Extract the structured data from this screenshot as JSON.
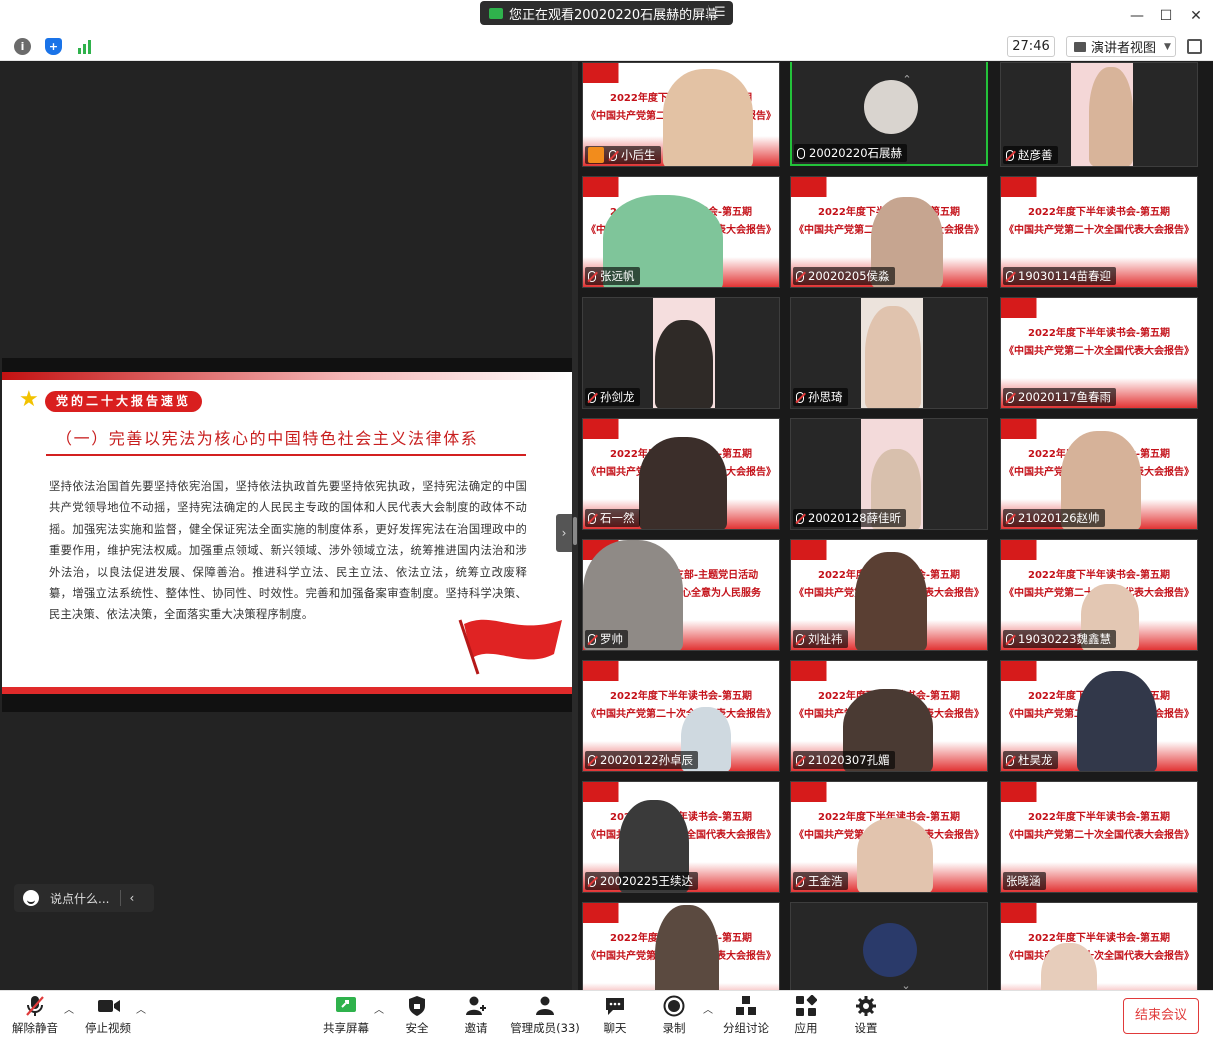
{
  "titlebar": {
    "sharing_text": "您正在观看20020220石展赫的屏幕",
    "colors": {
      "sharing_pill": "#2d2d2d",
      "share_icon": "#2fb24c"
    }
  },
  "toolbar": {
    "timer": "27:46",
    "view_label": "演讲者视图"
  },
  "slide": {
    "tag": "党的二十大报告速览",
    "title": "（一）完善以宪法为核心的中国特色社会主义法律体系",
    "body": "坚持依法治国首先要坚持依宪治国，坚持依法执政首先要坚持依宪执政，坚持宪法确定的中国共产党领导地位不动摇，坚持宪法确定的人民民主专政的国体和人民代表大会制度的政体不动摇。加强宪法实施和监督，健全保证宪法全面实施的制度体系，更好发挥宪法在治国理政中的重要作用，维护宪法权威。加强重点领域、新兴领域、涉外领域立法，统筹推进国内法治和涉外法治，以良法促进发展、保障善治。推进科学立法、民主立法、依法立法，统筹立改废释纂，增强立法系统性、整体性、协同性、时效性。完善和加强备案审查制度。坚持科学决策、民主决策、依法决策，全面落实重大决策程序制度。",
    "colors": {
      "accent": "#d91f1f"
    }
  },
  "chat": {
    "placeholder": "说点什么..."
  },
  "poster": {
    "line1": "2022年度下半年读书会-第五期",
    "line2": "《中国共产党第二十次全国代表大会报告》",
    "alt_line1": "学生党支部-主题党日活动",
    "alt_line2": "心全意为人民服务"
  },
  "participants": [
    {
      "name": "小后生"
    },
    {
      "name": "20020220石展赫"
    },
    {
      "name": "赵彦善"
    },
    {
      "name": "张远帆"
    },
    {
      "name": "20020205侯淼"
    },
    {
      "name": "19030114苗春迎"
    },
    {
      "name": "孙剑龙"
    },
    {
      "name": "孙思琦"
    },
    {
      "name": "20020117鱼春雨"
    },
    {
      "name": "石一然"
    },
    {
      "name": "20020128薛佳昕"
    },
    {
      "name": "21020126赵帅"
    },
    {
      "name": "罗帅"
    },
    {
      "name": "刘祉祎"
    },
    {
      "name": "19030223魏鑫慧"
    },
    {
      "name": "20020122孙卓辰"
    },
    {
      "name": "21020307孔媚"
    },
    {
      "name": "杜昊龙"
    },
    {
      "name": "20020225王续达"
    },
    {
      "name": "王金浩"
    },
    {
      "name": "张晓涵"
    }
  ],
  "bottombar": {
    "unmute": "解除静音",
    "stop_video": "停止视频",
    "share_screen": "共享屏幕",
    "security": "安全",
    "invite": "邀请",
    "manage_members": "管理成员(33)",
    "chat": "聊天",
    "record": "录制",
    "breakout": "分组讨论",
    "apps": "应用",
    "settings": "设置",
    "end_meeting": "结束会议"
  }
}
